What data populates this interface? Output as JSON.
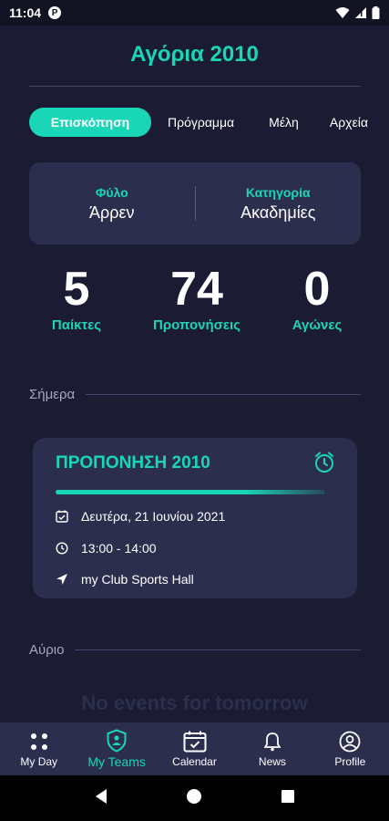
{
  "status_bar": {
    "time": "11:04",
    "app_icon": "P"
  },
  "header": {
    "title": "Αγόρια 2010"
  },
  "tabs": [
    {
      "label": "Επισκόπηση",
      "active": true
    },
    {
      "label": "Πρόγραμμα",
      "active": false
    },
    {
      "label": "Μέλη",
      "active": false
    },
    {
      "label": "Αρχεία",
      "active": false
    }
  ],
  "info": {
    "gender_label": "Φύλο",
    "gender_value": "Άρρεν",
    "category_label": "Κατηγορία",
    "category_value": "Ακαδημίες"
  },
  "stats": [
    {
      "value": "5",
      "label": "Παίκτες"
    },
    {
      "value": "74",
      "label": "Προπονήσεις"
    },
    {
      "value": "0",
      "label": "Αγώνες"
    }
  ],
  "today": {
    "label": "Σήμερα",
    "event": {
      "title": "ΠΡΟΠΟΝΗΣΗ 2010",
      "date": "Δευτέρα, 21 Ιουνίου 2021",
      "time": "13:00 - 14:00",
      "location": "my Club Sports Hall"
    }
  },
  "tomorrow": {
    "label": "Αύριο",
    "empty_text": "No events for tomorrow"
  },
  "bottom_nav": [
    {
      "label": "My Day",
      "icon": "grid-icon",
      "active": false
    },
    {
      "label": "My Teams",
      "icon": "team-shield-icon",
      "active": true
    },
    {
      "label": "Calendar",
      "icon": "calendar-icon",
      "active": false
    },
    {
      "label": "News",
      "icon": "bell-icon",
      "active": false
    },
    {
      "label": "Profile",
      "icon": "profile-icon",
      "active": false
    }
  ],
  "colors": {
    "background": "#1b1c33",
    "card": "#2c2e4e",
    "accent": "#19d7b6",
    "muted_text": "#a4a7c2"
  }
}
